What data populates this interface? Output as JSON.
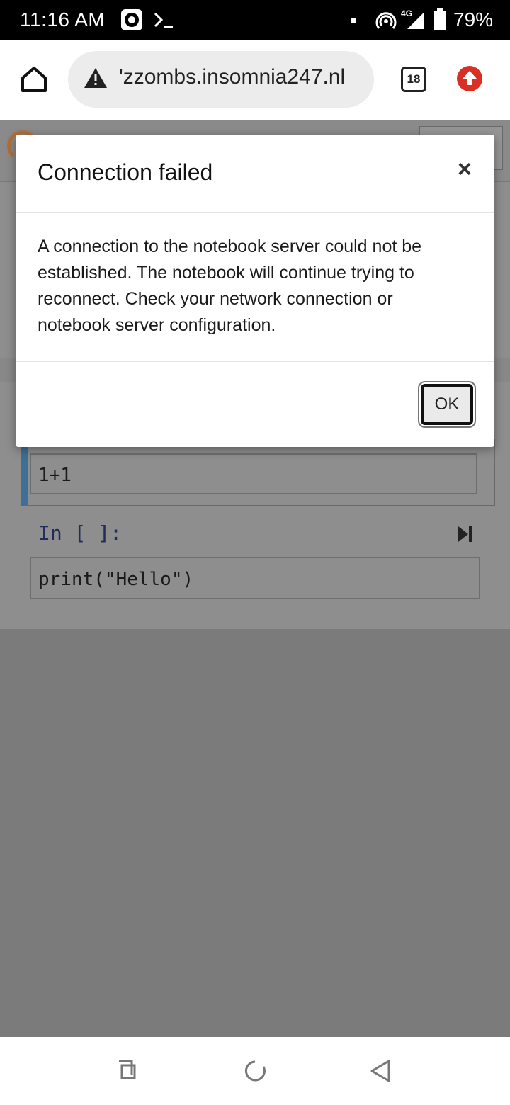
{
  "status_bar": {
    "time": "11:16 AM",
    "network_label": "4G",
    "battery": "79%",
    "icons": [
      "record-icon",
      "terminal-icon",
      "notification-dot-icon",
      "hotspot-icon",
      "signal-icon",
      "battery-icon"
    ]
  },
  "browser": {
    "url": "'zzombs.insomnia247.nl",
    "tab_count": "18",
    "icons": [
      "home-icon",
      "not-secure-warning-icon",
      "tabs-icon",
      "update-arrow-icon"
    ]
  },
  "notebook": {
    "cell1_code": "1+1",
    "cell2_prompt": "In [ ]:",
    "cell2_code": "print(\"Hello\")",
    "accent_color": "#3f6e96"
  },
  "dialog": {
    "title": "Connection failed",
    "close_label": "×",
    "body": "A connection to the notebook server could not be established. The notebook will continue trying to reconnect. Check your network connection or notebook server configuration.",
    "ok_label": "OK"
  },
  "nav_bar": {
    "icons": [
      "recents-icon",
      "home-circle-icon",
      "back-icon"
    ]
  }
}
